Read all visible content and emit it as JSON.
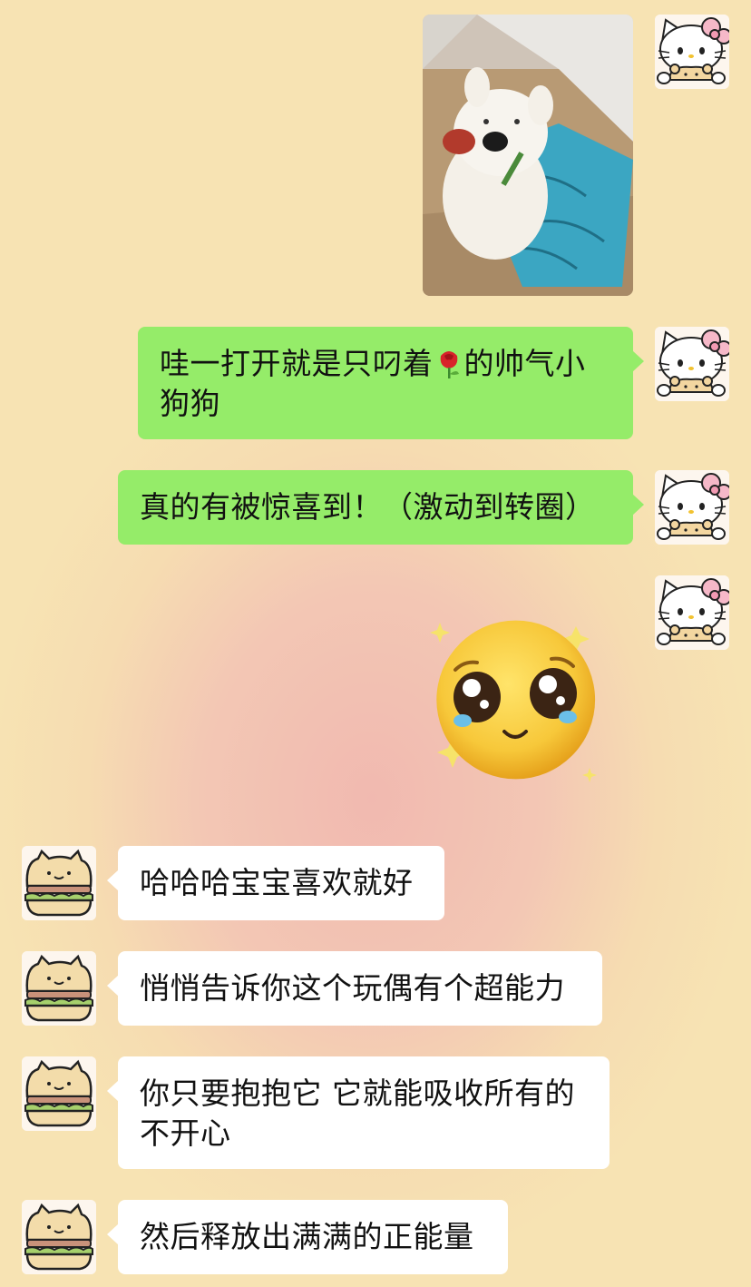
{
  "chat": {
    "messages": [
      {
        "side": "right",
        "type": "image",
        "icon": "plush-dog-photo"
      },
      {
        "side": "right",
        "type": "text",
        "text_before": "哇一打开就是只叼着",
        "emoji": "rose-emoji",
        "text_after": "的帅气小狗狗"
      },
      {
        "side": "right",
        "type": "text",
        "text": "真的有被惊喜到！（激动到转圈）"
      },
      {
        "side": "right",
        "type": "sticker",
        "icon": "teary-smile-emoji"
      },
      {
        "side": "left",
        "type": "text",
        "text": "哈哈哈宝宝喜欢就好"
      },
      {
        "side": "left",
        "type": "text",
        "text": "悄悄告诉你这个玩偶有个超能力"
      },
      {
        "side": "left",
        "type": "text",
        "text": "你只要抱抱它 它就能吸收所有的不开心"
      },
      {
        "side": "left",
        "type": "text",
        "text": "然后释放出满满的正能量"
      }
    ]
  },
  "avatars": {
    "me": "hello-kitty-avatar",
    "other": "sandwich-cat-avatar"
  },
  "colors": {
    "sent_bubble": "#95ec69",
    "received_bubble": "#ffffff",
    "background_warm": "#f7e3b3",
    "background_pink": "#f1b9b0"
  }
}
